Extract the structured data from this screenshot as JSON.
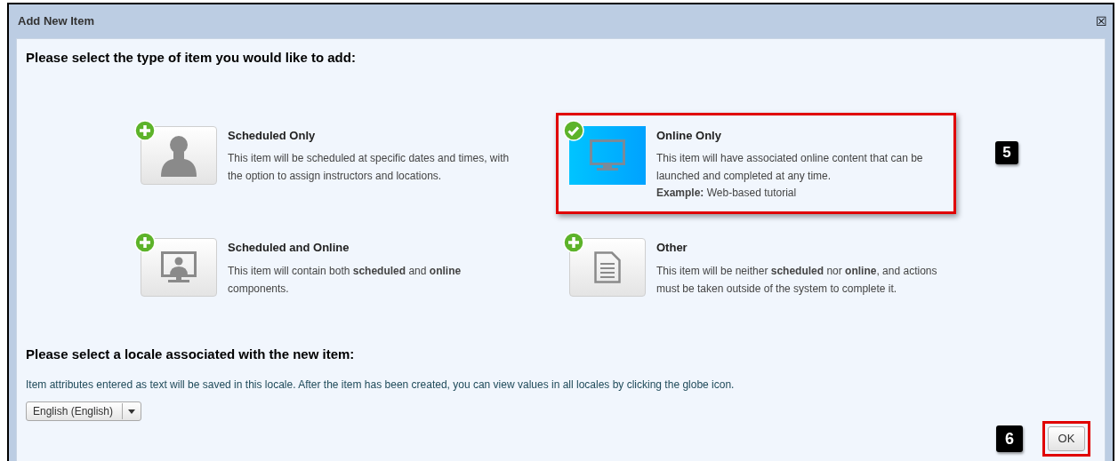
{
  "window": {
    "title": "Add New Item",
    "close": "☒"
  },
  "type_section": {
    "heading": "Please select the type of item you would like to add:",
    "options": [
      {
        "kind": "person",
        "selected": false,
        "title": "Scheduled Only",
        "description": "This item will be scheduled at specific dates and times, with the option to assign instructors and locations."
      },
      {
        "kind": "monitor",
        "selected": true,
        "title": "Online Only",
        "description": "This item will have associated online content that can be launched and completed at any time.",
        "example": "**Example:** Web-based tutorial"
      },
      {
        "kind": "monitor-person",
        "selected": false,
        "title": "Scheduled and Online",
        "description": "This item will contain both **scheduled** and **online** components."
      },
      {
        "kind": "document",
        "selected": false,
        "title": "Other",
        "description": "This item will be neither **scheduled** nor **online**, and actions must be taken outside of the system to complete it."
      }
    ],
    "callout": "5"
  },
  "locale_section": {
    "heading": "Please select a locale associated with the new item:",
    "note": "Item attributes entered as text will be saved in this locale. After the item has been created, you can view values in all locales by clicking the globe icon.",
    "dropdown": {
      "value": "English (English)"
    }
  },
  "ok_button": {
    "label": "OK",
    "highlighted": true,
    "callout": "6"
  }
}
